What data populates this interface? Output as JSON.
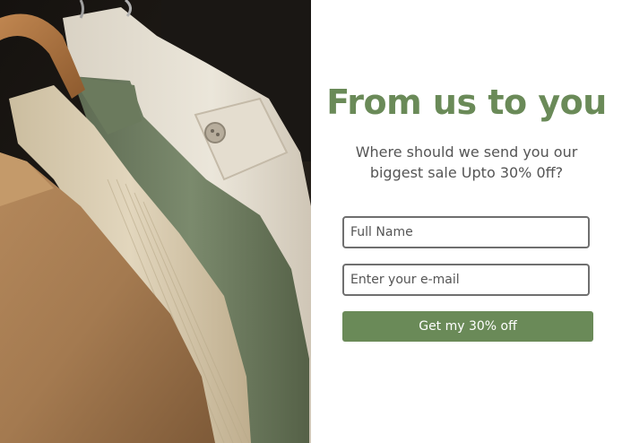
{
  "popup": {
    "title": "From us to you",
    "subtitle": "Where should we send you our biggest sale Upto 30% 0ff?",
    "name_field": {
      "placeholder": "Full Name",
      "value": ""
    },
    "email_field": {
      "placeholder": "Enter your e-mail",
      "value": ""
    },
    "cta_label": "Get my 30% off"
  },
  "colors": {
    "accent": "#6a8a58",
    "title": "#6a8a58",
    "subtitle": "#555555",
    "field_border": "#6f6f6f"
  },
  "image": {
    "alt_subject": "jackets-on-hangers-photo"
  }
}
